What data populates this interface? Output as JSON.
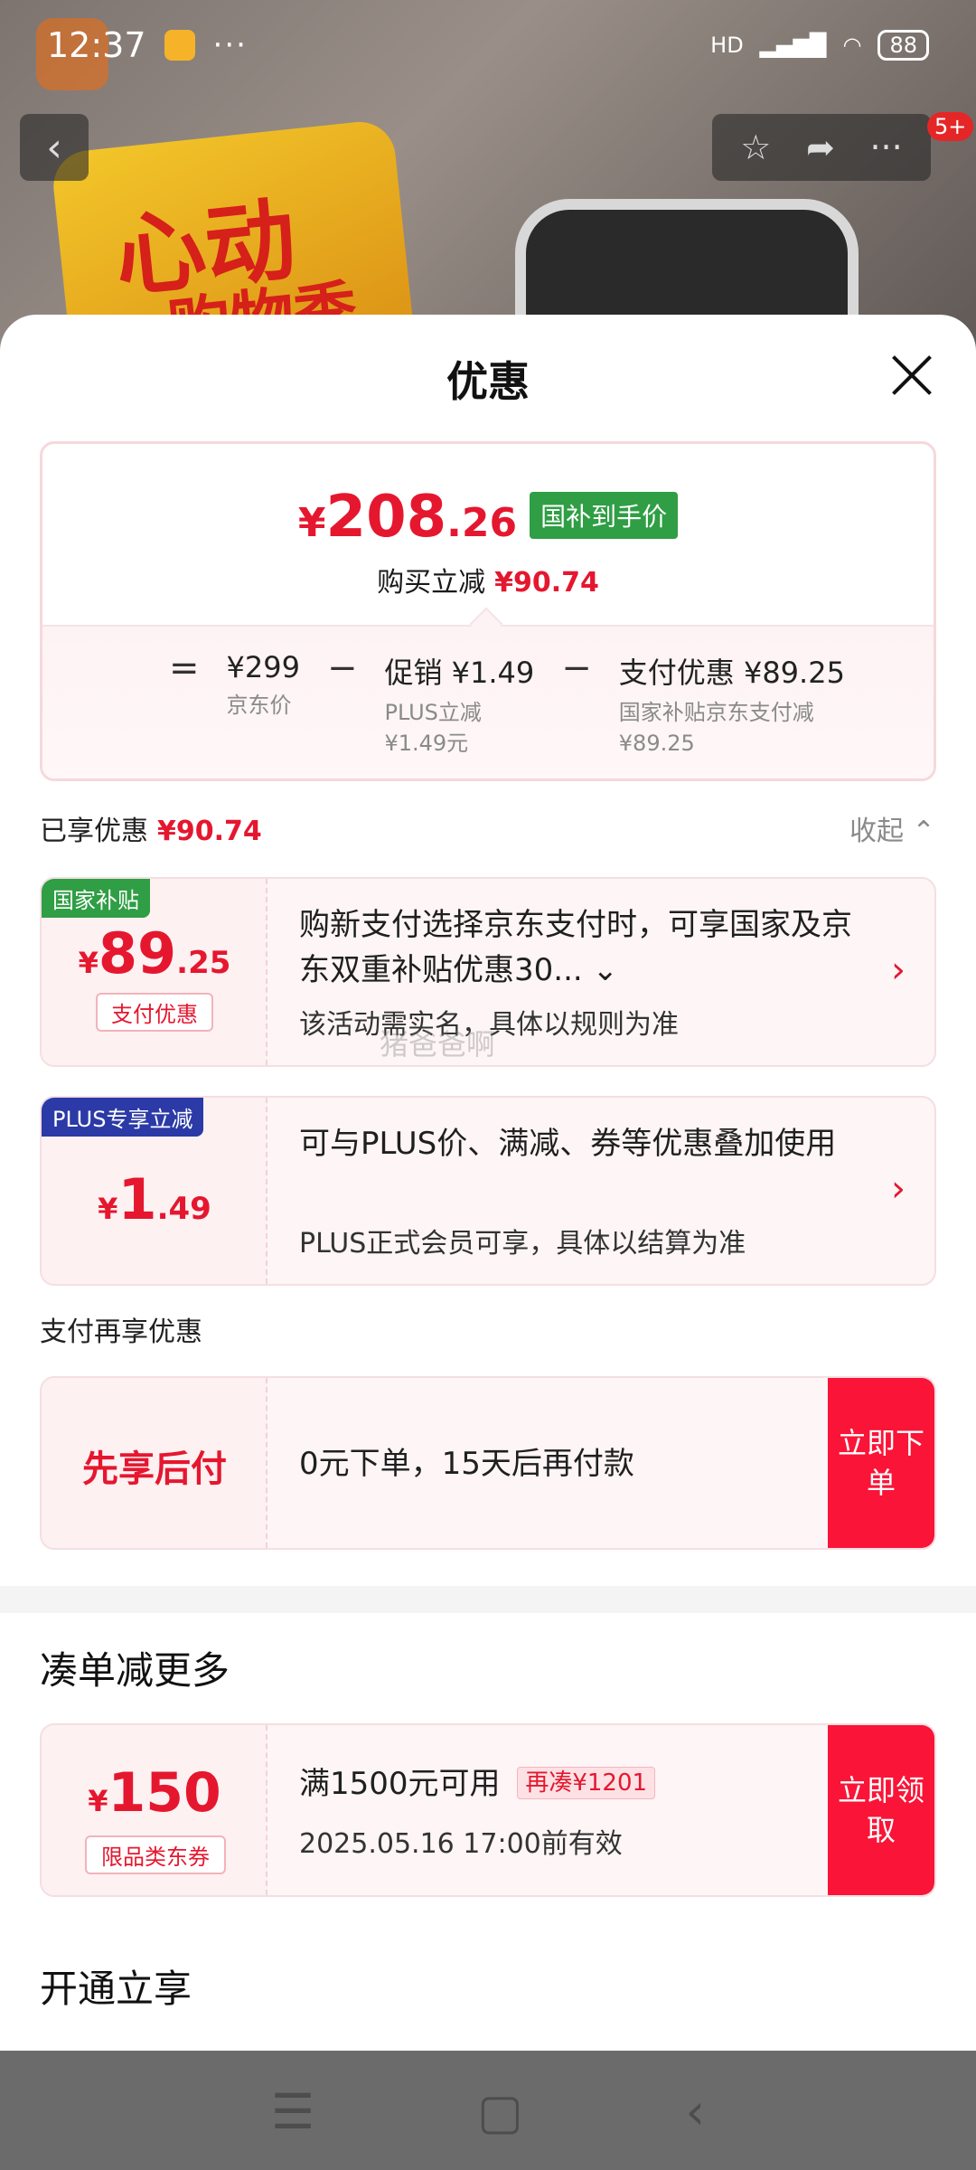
{
  "status_bar": {
    "time": "12:37",
    "more": "···",
    "network": "HD",
    "battery": "88"
  },
  "top_nav": {
    "back": "‹",
    "star": "☆",
    "share": "➦",
    "more": "···",
    "badge": "5+"
  },
  "background": {
    "headline_1": "心动",
    "headline_2": "购物季"
  },
  "sheet": {
    "title": "优惠",
    "summary": {
      "currency": "¥",
      "price_int": "208",
      "price_dec": ".26",
      "price_tag": "国补到手价",
      "saving_label": "购买立减",
      "saving_value": "¥90.74",
      "formula": {
        "eq": "=",
        "minus": "−",
        "base_value": "¥299",
        "base_label": "京东价",
        "promo_value": "促销 ¥1.49",
        "promo_label_1": "PLUS立减",
        "promo_label_2": "¥1.49元",
        "pay_value": "支付优惠 ¥89.25",
        "pay_label_1": "国家补贴京东支付减",
        "pay_label_2": "¥89.25"
      }
    },
    "enjoyed": {
      "label": "已享优惠",
      "value": "¥90.74",
      "collapse": "收起 ⌃"
    },
    "offers": [
      {
        "flag": "国家补贴",
        "currency": "¥",
        "int": "89",
        "dec": ".25",
        "pill": "支付优惠",
        "text": "购新支付选择京东支付时，可享国家及京东双重补贴优惠30... ⌄",
        "sub": "该活动需实名，具体以规则为准"
      },
      {
        "flag": "PLUS专享立减",
        "currency": "¥",
        "int": "1",
        "dec": ".49",
        "text": "可与PLUS价、满减、券等优惠叠加使用",
        "sub": "PLUS正式会员可享，具体以结算为准"
      }
    ],
    "pay_more": {
      "label": "支付再享优惠",
      "title": "先享后付",
      "text": "0元下单，15天后再付款",
      "cta": "立即下单"
    },
    "bundle": {
      "heading": "凑单减更多",
      "currency": "¥",
      "amount": "150",
      "pill": "限品类东券",
      "condition": "满1500元可用",
      "tag": "再凑¥1201",
      "valid": "2025.05.16 17:00前有效",
      "cta": "立即领取"
    },
    "open_now": {
      "heading": "开通立享"
    }
  },
  "watermark": "猪爸爸啊",
  "nav_bar": {
    "menu": "☰",
    "home": "▢",
    "back": "‹"
  },
  "colors": {
    "accent": "#e5172f",
    "cta": "#fa1437",
    "green_tag": "#2f9e44",
    "plus_flag": "#2b3aa6"
  }
}
